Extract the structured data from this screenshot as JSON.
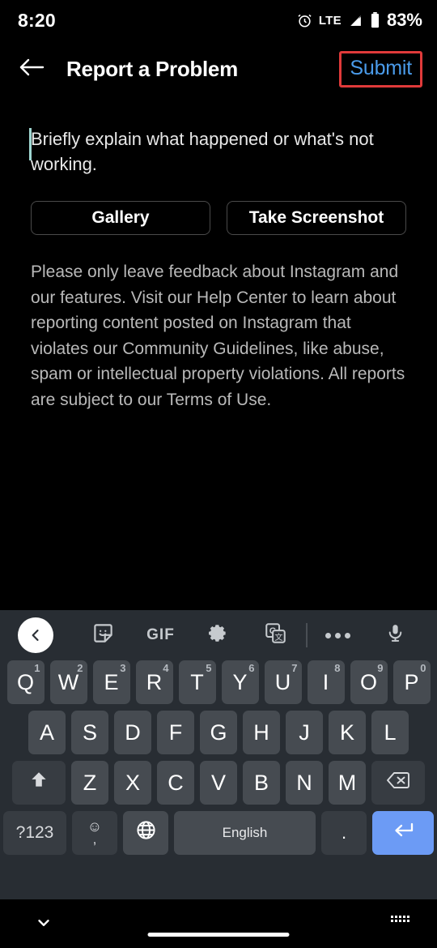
{
  "status_bar": {
    "time": "8:20",
    "network": "LTE",
    "battery": "83%",
    "icons": [
      "alarm-icon",
      "signal-icon",
      "battery-icon"
    ]
  },
  "header": {
    "back_icon": "arrow-left-icon",
    "title": "Report a Problem",
    "submit_label": "Submit",
    "submit_color": "#4a9bea",
    "highlight_color": "#e03a3a"
  },
  "main": {
    "input_placeholder": "Briefly explain what happened or what's not working.",
    "input_value": "",
    "buttons": [
      {
        "label": "Gallery",
        "name": "gallery-button"
      },
      {
        "label": "Take Screenshot",
        "name": "take-screenshot-button"
      }
    ],
    "disclaimer": "Please only leave feedback about Instagram and our features. Visit our Help Center to learn about reporting content posted on Instagram that violates our Community Guidelines, like abuse, spam or intellectual property violations. All reports are subject to our Terms of Use."
  },
  "keyboard": {
    "toolbar": [
      {
        "name": "collapse-toolbar-button",
        "icon": "chevron-left-icon",
        "label": ""
      },
      {
        "name": "sticker-button",
        "icon": "sticker-icon",
        "label": ""
      },
      {
        "name": "gif-button",
        "icon": "gif-icon",
        "label": "GIF"
      },
      {
        "name": "settings-button",
        "icon": "gear-icon",
        "label": ""
      },
      {
        "name": "translate-button",
        "icon": "google-translate-icon",
        "label": ""
      },
      {
        "name": "more-options-button",
        "icon": "ellipsis-icon",
        "label": ""
      },
      {
        "name": "voice-input-button",
        "icon": "microphone-icon",
        "label": ""
      }
    ],
    "row1": [
      {
        "key": "Q",
        "num": "1"
      },
      {
        "key": "W",
        "num": "2"
      },
      {
        "key": "E",
        "num": "3"
      },
      {
        "key": "R",
        "num": "4"
      },
      {
        "key": "T",
        "num": "5"
      },
      {
        "key": "Y",
        "num": "6"
      },
      {
        "key": "U",
        "num": "7"
      },
      {
        "key": "I",
        "num": "8"
      },
      {
        "key": "O",
        "num": "9"
      },
      {
        "key": "P",
        "num": "0"
      }
    ],
    "row2": [
      "A",
      "S",
      "D",
      "F",
      "G",
      "H",
      "J",
      "K",
      "L"
    ],
    "row3": [
      "Z",
      "X",
      "C",
      "V",
      "B",
      "N",
      "M"
    ],
    "shift_icon": "shift-up-arrow-icon",
    "backspace_icon": "backspace-icon",
    "symbols_label": "?123",
    "emoji_top": "☺",
    "emoji_bottom": ",",
    "globe_icon": "globe-icon",
    "space_label": "English",
    "period_label": ".",
    "enter_icon": "enter-return-icon",
    "enter_color": "#6c9bf5"
  },
  "nav_bar": {
    "dismiss_icon": "chevron-down-icon",
    "home_indicator": "home-gesture-bar",
    "switch_keyboard_icon": "keyboard-switch-icon"
  }
}
